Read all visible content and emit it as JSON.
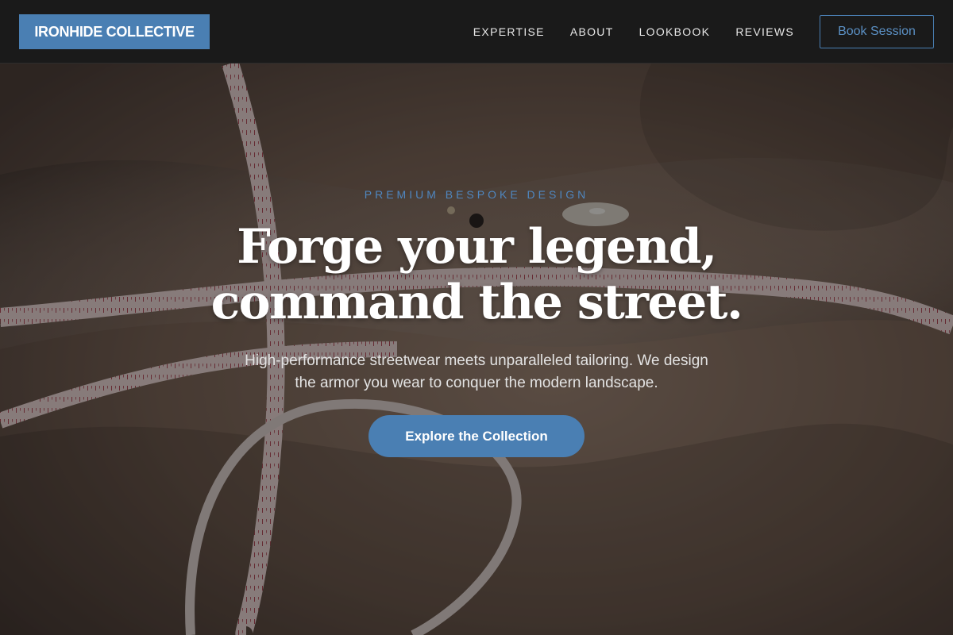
{
  "brand": {
    "name": "IRONHIDE COLLECTIVE"
  },
  "nav": {
    "items": [
      {
        "label": "EXPERTISE"
      },
      {
        "label": "ABOUT"
      },
      {
        "label": "LOOKBOOK"
      },
      {
        "label": "REVIEWS"
      }
    ],
    "cta_label": "Book Session"
  },
  "hero": {
    "eyebrow": "PREMIUM BESPOKE DESIGN",
    "headline_line1": "Forge your legend,",
    "headline_line2": "command the street.",
    "subtext_line1": "High-performance streetwear meets unparalleled tailoring. We design",
    "subtext_line2": "the armor you wear to conquer the modern landscape.",
    "cta_label": "Explore the Collection",
    "background_image": "tailoring-fabric-measuring-tape-photo"
  },
  "colors": {
    "accent": "#4a7fb3",
    "header_bg": "#1a1a1a",
    "text_light": "#ffffff",
    "fabric": "#7a6658"
  }
}
